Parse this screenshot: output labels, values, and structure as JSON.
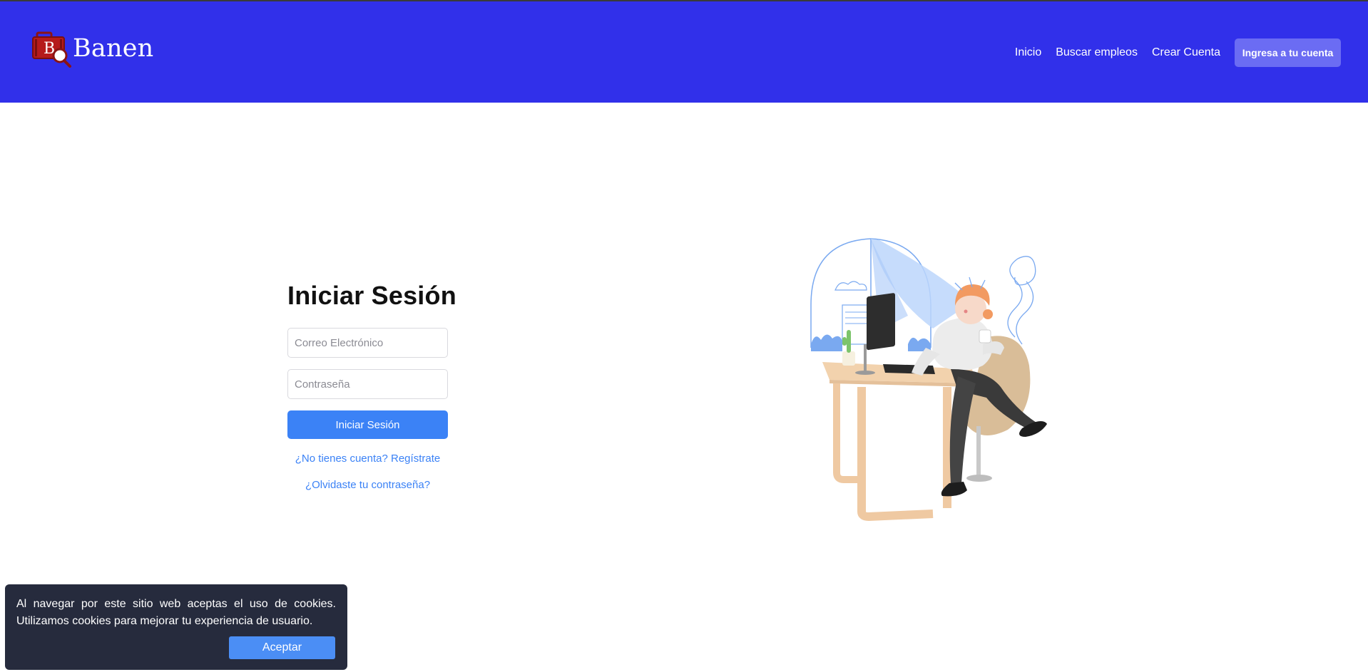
{
  "header": {
    "brand_name": "Banen",
    "logo_letter": "B",
    "colors": {
      "background": "#3130ea",
      "cta": "#6b6cf3"
    },
    "nav": [
      {
        "label": "Inicio"
      },
      {
        "label": "Buscar empleos"
      },
      {
        "label": "Crear Cuenta"
      }
    ],
    "cta_label": "Ingresa a tu cuenta"
  },
  "login": {
    "title": "Iniciar Sesión",
    "email_placeholder": "Correo Electrónico",
    "password_placeholder": "Contraseña",
    "submit_label": "Iniciar Sesión",
    "register_link": "¿No tienes cuenta? Regístrate",
    "forgot_link": "¿Olvidaste tu contraseña?",
    "accent_color": "#3b82f6"
  },
  "illustration": {
    "icon": "woman-at-desk-illustration"
  },
  "cookie_banner": {
    "message": "Al navegar por este sitio web aceptas el uso de cookies. Utilizamos cookies para mejorar tu experiencia de usuario.",
    "accept_label": "Aceptar"
  }
}
